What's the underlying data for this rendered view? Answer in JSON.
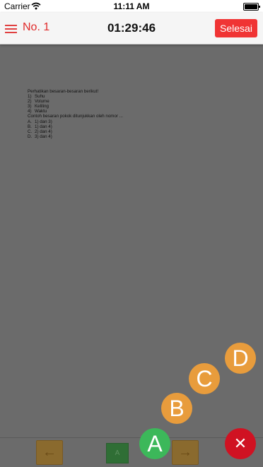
{
  "status_bar": {
    "carrier": "Carrier",
    "time": "11:11 AM"
  },
  "nav": {
    "title": "No. 1",
    "timer": "01:29:46",
    "finish_label": "Selesai"
  },
  "question": {
    "intro": "Perhatikan besaran-besaran berikut!",
    "items": [
      {
        "num": "1)",
        "text": "Suhu"
      },
      {
        "num": "2)",
        "text": "Volume"
      },
      {
        "num": "3)",
        "text": "Keliling"
      },
      {
        "num": "4)",
        "text": "Waktu"
      }
    ],
    "prompt": "Contoh besaran pokok ditunjukkan oleh nomor ...",
    "options": [
      {
        "letter": "A.",
        "text": "1) dan 3)"
      },
      {
        "letter": "B.",
        "text": "1) dan 4)"
      },
      {
        "letter": "C.",
        "text": "2) dan 4)"
      },
      {
        "letter": "D.",
        "text": "3) dan 4)"
      }
    ]
  },
  "bottom": {
    "prev_icon": "arrow-left-icon",
    "next_icon": "arrow-right-icon",
    "prev_symbol": "←",
    "next_symbol": "→",
    "selected_answer": "A"
  },
  "fab": {
    "options": [
      "A",
      "B",
      "C",
      "D"
    ],
    "close_symbol": "✕",
    "colors": {
      "option": "#e89c3c",
      "selected": "#3cb85a",
      "close": "#d01222"
    }
  }
}
